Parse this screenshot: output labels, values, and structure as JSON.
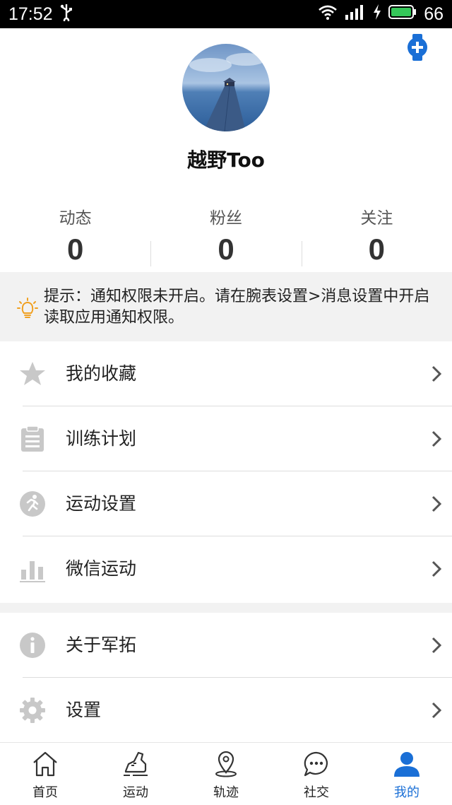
{
  "status_bar": {
    "time": "17:52",
    "battery": "66"
  },
  "profile": {
    "name": "越野Too"
  },
  "stats": [
    {
      "label": "动态",
      "value": "0"
    },
    {
      "label": "粉丝",
      "value": "0"
    },
    {
      "label": "关注",
      "value": "0"
    }
  ],
  "tip": {
    "text": "提示：通知权限未开启。请在腕表设置>消息设置中开启读取应用通知权限。"
  },
  "menu_group_1": [
    {
      "label": "我的收藏",
      "icon": "star-icon"
    },
    {
      "label": "训练计划",
      "icon": "clipboard-icon"
    },
    {
      "label": "运动设置",
      "icon": "runner-icon"
    },
    {
      "label": "微信运动",
      "icon": "bar-chart-icon"
    }
  ],
  "menu_group_2": [
    {
      "label": "关于军拓",
      "icon": "info-icon"
    },
    {
      "label": "设置",
      "icon": "gear-icon"
    }
  ],
  "tabs": [
    {
      "label": "首页",
      "icon": "home-icon"
    },
    {
      "label": "运动",
      "icon": "shoe-icon"
    },
    {
      "label": "轨迹",
      "icon": "location-pin-icon"
    },
    {
      "label": "社交",
      "icon": "chat-bubble-icon"
    },
    {
      "label": "我的",
      "icon": "user-icon",
      "active": true
    }
  ],
  "colors": {
    "accent": "#1a6fd6",
    "icon_gray": "#c8c8c8",
    "tip_bulb": "#f0a020"
  }
}
